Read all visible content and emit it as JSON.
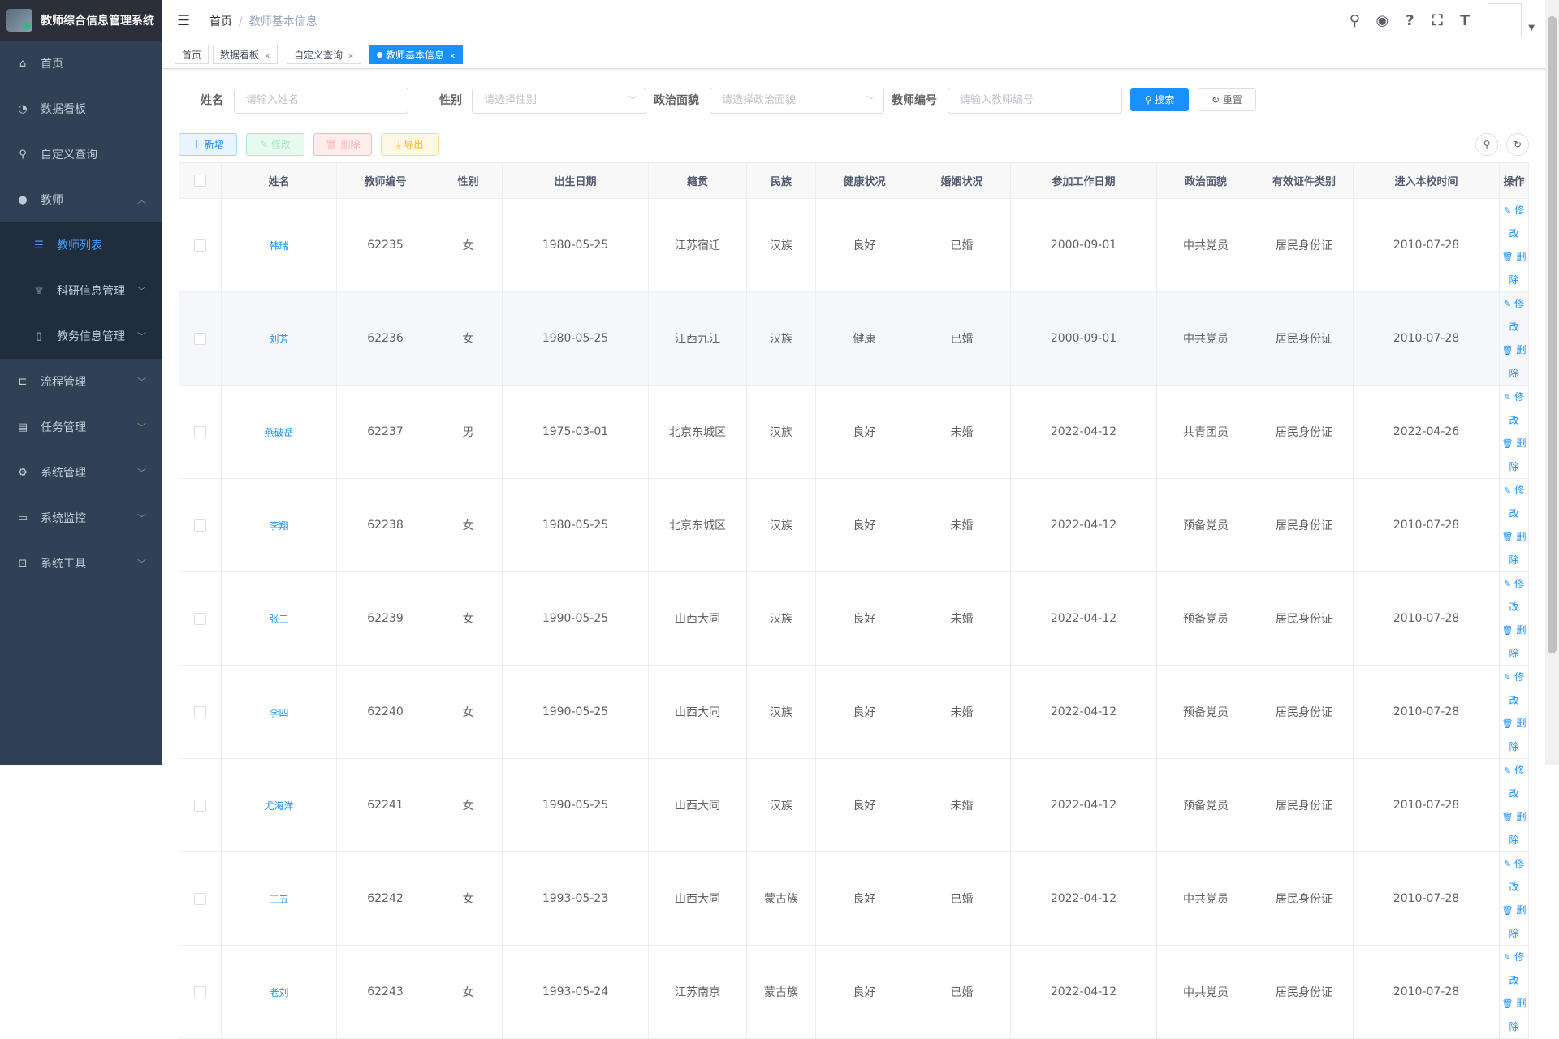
{
  "app": {
    "title": "教师综合信息管理系统"
  },
  "sidebar": {
    "items": [
      {
        "label": "首页",
        "icon": "home-icon"
      },
      {
        "label": "数据看板",
        "icon": "dashboard-icon"
      },
      {
        "label": "自定义查询",
        "icon": "search-icon"
      },
      {
        "label": "教师",
        "icon": "user-icon"
      },
      {
        "label": "教师列表",
        "icon": "list-icon"
      },
      {
        "label": "科研信息管理",
        "icon": "trophy-icon"
      },
      {
        "label": "教务信息管理",
        "icon": "book-icon"
      },
      {
        "label": "流程管理",
        "icon": "flow-icon"
      },
      {
        "label": "任务管理",
        "icon": "task-icon"
      },
      {
        "label": "系统管理",
        "icon": "gear-icon"
      },
      {
        "label": "系统监控",
        "icon": "monitor-icon"
      },
      {
        "label": "系统工具",
        "icon": "toolbox-icon"
      }
    ]
  },
  "navbar": {
    "breadcrumb": [
      "首页",
      "教师基本信息"
    ],
    "sep": "/"
  },
  "tags": [
    {
      "label": "首页"
    },
    {
      "label": "数据看板"
    },
    {
      "label": "自定义查询"
    },
    {
      "label": "教师基本信息"
    }
  ],
  "search": {
    "name_label": "姓名",
    "name_placeholder": "请输入姓名",
    "gender_label": "性别",
    "gender_placeholder": "请选择性别",
    "politics_label": "政治面貌",
    "politics_placeholder": "请选择政治面貌",
    "id_label": "教师编号",
    "id_placeholder": "请输入教师编号",
    "search_btn": "搜索",
    "reset_btn": "重置"
  },
  "toolbar": {
    "add": "新增",
    "edit": "修改",
    "delete": "删除",
    "export": "导出"
  },
  "table": {
    "headers": [
      "姓名",
      "教师编号",
      "性别",
      "出生日期",
      "籍贯",
      "民族",
      "健康状况",
      "婚姻状况",
      "参加工作日期",
      "政治面貌",
      "有效证件类别",
      "进入本校时间",
      "操作"
    ],
    "op_edit": "修改",
    "op_delete": "删除",
    "rows": [
      [
        "韩瑞",
        "62235",
        "女",
        "1980-05-25",
        "江苏宿迁",
        "汉族",
        "良好",
        "已婚",
        "2000-09-01",
        "中共党员",
        "居民身份证",
        "2010-07-28"
      ],
      [
        "刘芳",
        "62236",
        "女",
        "1980-05-25",
        "江西九江",
        "汉族",
        "健康",
        "已婚",
        "2000-09-01",
        "中共党员",
        "居民身份证",
        "2010-07-28"
      ],
      [
        "燕破岳",
        "62237",
        "男",
        "1975-03-01",
        "北京东城区",
        "汉族",
        "良好",
        "未婚",
        "2022-04-12",
        "共青团员",
        "居民身份证",
        "2022-04-26"
      ],
      [
        "李翔",
        "62238",
        "女",
        "1980-05-25",
        "北京东城区",
        "汉族",
        "良好",
        "未婚",
        "2022-04-12",
        "预备党员",
        "居民身份证",
        "2010-07-28"
      ],
      [
        "张三",
        "62239",
        "女",
        "1990-05-25",
        "山西大同",
        "汉族",
        "良好",
        "未婚",
        "2022-04-12",
        "预备党员",
        "居民身份证",
        "2010-07-28"
      ],
      [
        "李四",
        "62240",
        "女",
        "1990-05-25",
        "山西大同",
        "汉族",
        "良好",
        "未婚",
        "2022-04-12",
        "预备党员",
        "居民身份证",
        "2010-07-28"
      ],
      [
        "尤海洋",
        "62241",
        "女",
        "1990-05-25",
        "山西大同",
        "汉族",
        "良好",
        "未婚",
        "2022-04-12",
        "预备党员",
        "居民身份证",
        "2010-07-28"
      ],
      [
        "王五",
        "62242",
        "女",
        "1993-05-23",
        "山西大同",
        "蒙古族",
        "良好",
        "已婚",
        "2022-04-12",
        "中共党员",
        "居民身份证",
        "2010-07-28"
      ],
      [
        "老刘",
        "62243",
        "女",
        "1993-05-24",
        "江苏南京",
        "蒙古族",
        "良好",
        "已婚",
        "2022-04-12",
        "中共党员",
        "居民身份证",
        "2010-07-28"
      ]
    ]
  },
  "colors": {
    "primary": "#1890ff",
    "sidebar_bg": "#304156",
    "submenu_bg": "#1f2d3d"
  }
}
